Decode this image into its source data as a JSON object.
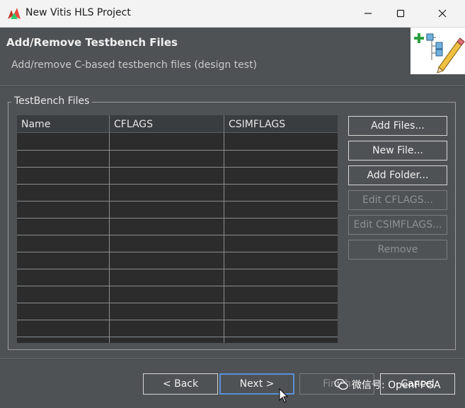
{
  "window": {
    "title": "New Vitis HLS Project",
    "controls": [
      "minimize",
      "maximize",
      "close"
    ]
  },
  "header": {
    "title": "Add/Remove Testbench Files",
    "description": "Add/remove C-based testbench files (design test)"
  },
  "group": {
    "label": "TestBench Files"
  },
  "table": {
    "columns": [
      "Name",
      "CFLAGS",
      "CSIMFLAGS"
    ],
    "rows": []
  },
  "side_buttons": [
    {
      "label": "Add Files...",
      "enabled": true
    },
    {
      "label": "New File...",
      "enabled": true
    },
    {
      "label": "Add Folder...",
      "enabled": true
    },
    {
      "label": "Edit CFLAGS...",
      "enabled": false
    },
    {
      "label": "Edit CSIMFLAGS...",
      "enabled": false
    },
    {
      "label": "Remove",
      "enabled": false
    }
  ],
  "footer": {
    "back_label": "< Back",
    "next_label": "Next >",
    "finish_label": "Finish",
    "cancel_label": "Cancel"
  },
  "watermark": {
    "text": "微信号: OpenFPGA"
  },
  "colors": {
    "dialog_bg": "#4f5254",
    "table_bg": "#2c2c2c",
    "focus_border": "#5b8fd6"
  }
}
